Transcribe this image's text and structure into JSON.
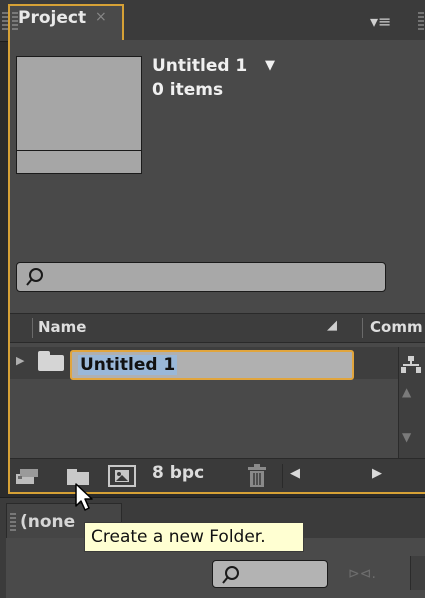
{
  "tabs": {
    "project_tab": "Project",
    "close_glyph": "×",
    "menu_glyph": "▾≡"
  },
  "project": {
    "name": "Untitled 1",
    "dropdown_glyph": "▼",
    "item_count": "0 items"
  },
  "columns": {
    "name": "Name",
    "sort_glyph": "◢",
    "comment_truncated": "Comm"
  },
  "list": {
    "rows": [
      {
        "label": "Untitled 1",
        "type": "folder",
        "editing": true
      }
    ]
  },
  "footer": {
    "bit_depth": "8 bpc",
    "nav_left": "◀",
    "nav_right": "▶"
  },
  "lower_panel": {
    "tab_label_truncated": "(none"
  },
  "tooltip": {
    "text": "Create a new Folder."
  },
  "colors": {
    "accent": "#d6a136",
    "panel_bg": "#494949",
    "selection": "#9ab8d8",
    "tooltip_bg": "#ffffd2"
  },
  "icons": [
    "panel-menu-icon",
    "search-icon",
    "folder-icon",
    "flowchart-icon",
    "interpret-footage-icon",
    "new-folder-icon",
    "new-composition-icon",
    "trash-icon",
    "mouse-cursor-icon"
  ]
}
